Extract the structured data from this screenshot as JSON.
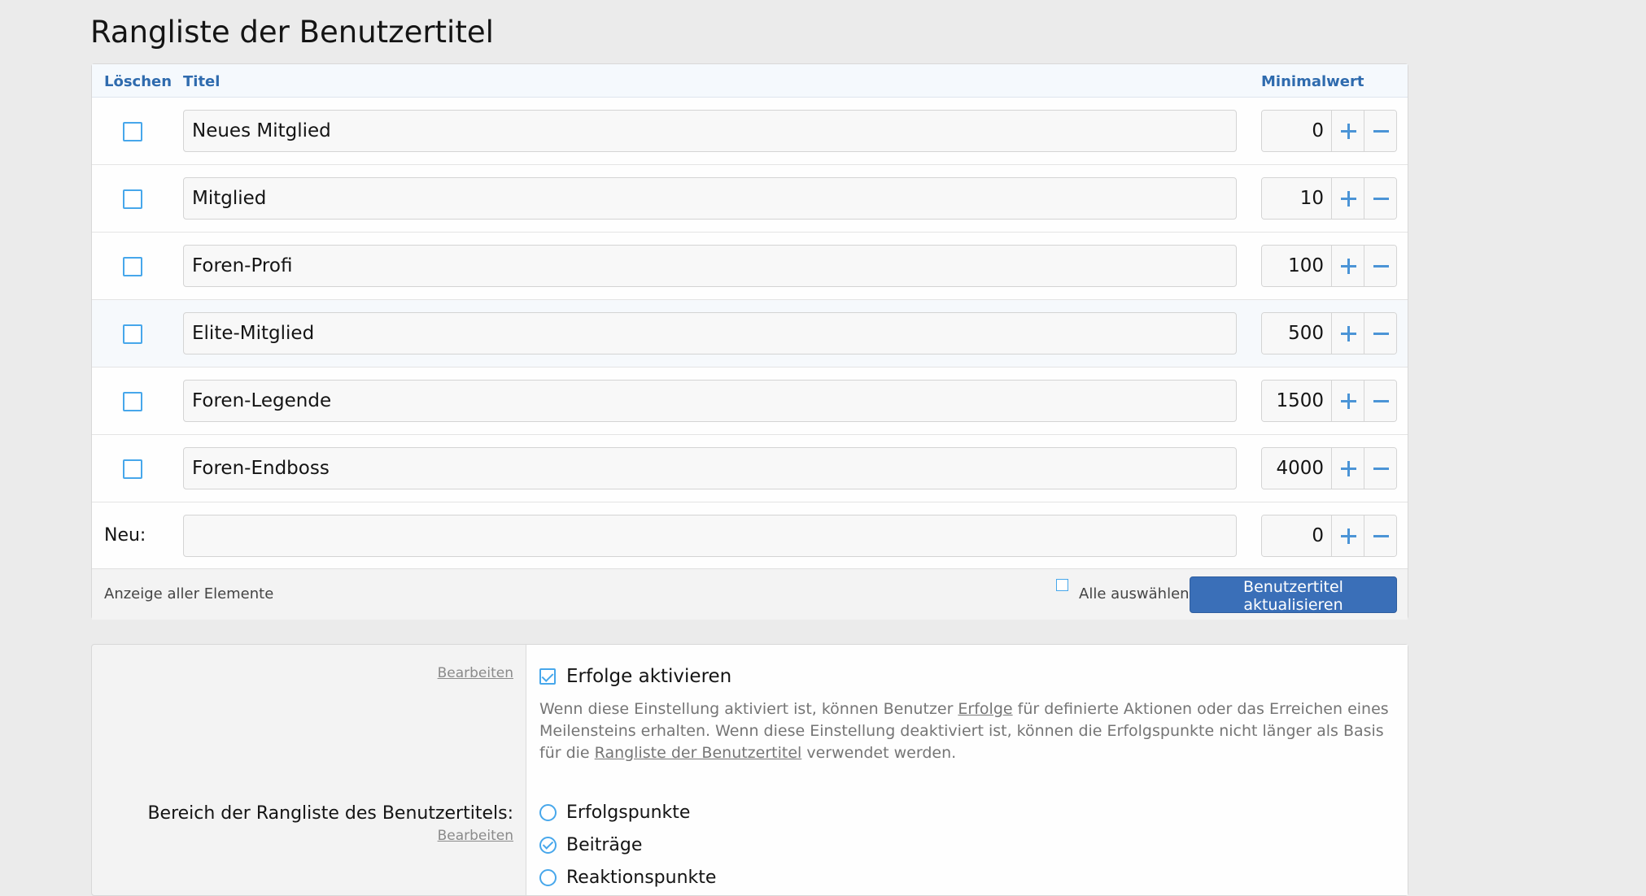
{
  "page_title": "Rangliste der Benutzertitel",
  "table": {
    "headers": {
      "delete": "Löschen",
      "title": "Titel",
      "min": "Minimalwert"
    },
    "rows": [
      {
        "title": "Neues Mitglied",
        "min": "0"
      },
      {
        "title": "Mitglied",
        "min": "10"
      },
      {
        "title": "Foren-Profi",
        "min": "100"
      },
      {
        "title": "Elite-Mitglied",
        "min": "500"
      },
      {
        "title": "Foren-Legende",
        "min": "1500"
      },
      {
        "title": "Foren-Endboss",
        "min": "4000"
      }
    ],
    "new_row": {
      "label": "Neu:",
      "title": "",
      "min": "0"
    },
    "footer": {
      "count_text": "Anzeige aller Elemente",
      "select_all": "Alle auswählen",
      "submit": "Benutzertitel aktualisieren"
    }
  },
  "options": {
    "edit_link": "Bearbeiten",
    "enable_achievements": {
      "label": "Erfolge aktivieren",
      "checked": true,
      "desc_part1": "Wenn diese Einstellung aktiviert ist, können Benutzer ",
      "desc_link1": "Erfolge",
      "desc_part2": " für definierte Aktionen oder das Erreichen eines Meilensteins erhalten. Wenn diese Einstellung deaktiviert ist, können die Erfolgspunkte nicht länger als Basis für die ",
      "desc_link2": "Rangliste der Benutzertitel",
      "desc_part3": " verwendet werden."
    },
    "range": {
      "label": "Bereich der Rangliste des Benutzertitels:",
      "choices": [
        "Erfolgspunkte",
        "Beiträge",
        "Reaktionspunkte"
      ],
      "selected": "Beiträge"
    }
  }
}
